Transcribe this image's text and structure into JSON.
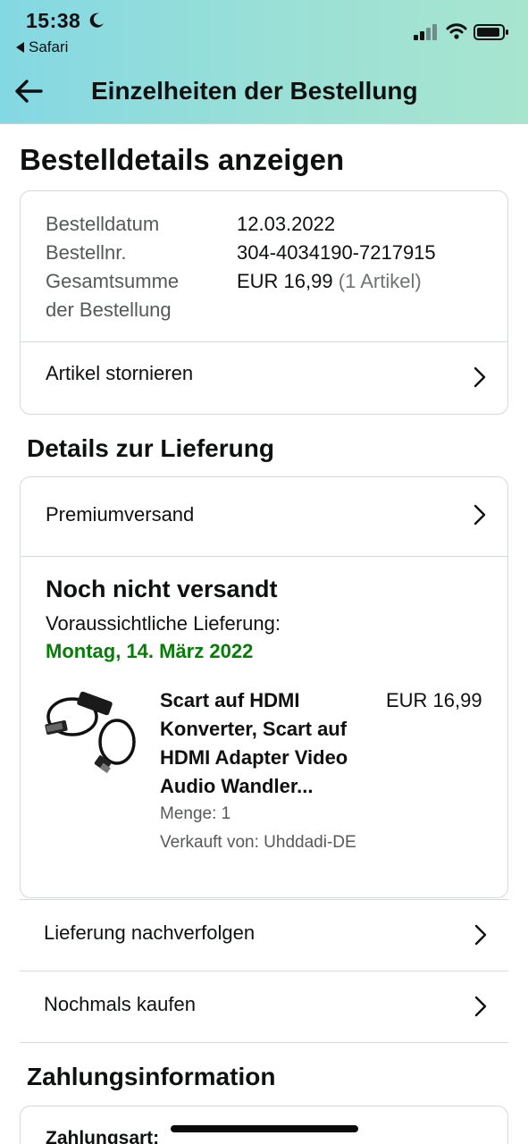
{
  "status_bar": {
    "time": "15:38",
    "back_app": "Safari"
  },
  "header": {
    "title": "Einzelheiten der Bestellung"
  },
  "page_title": "Bestelldetails anzeigen",
  "order_info": {
    "date_label": "Bestelldatum",
    "date_value": "12.03.2022",
    "number_label": "Bestellnr.",
    "number_value": "304-4034190-7217915",
    "total_label_line1": "Gesamtsumme",
    "total_label_line2": "der Bestellung",
    "total_value": "EUR 16,99",
    "total_items": "(1 Artikel)",
    "cancel_label": "Artikel stornieren"
  },
  "delivery": {
    "section_title": "Details zur Lieferung",
    "shipping_method": "Premiumversand",
    "status": "Noch nicht versandt",
    "expected_label": "Voraussichtliche Lieferung:",
    "expected_date": "Montag, 14. März 2022",
    "expected_date_color": "#067d06",
    "product": {
      "title_lines": [
        "Scart auf HDMI",
        "Konverter, Scart auf",
        "HDMI Adapter Video",
        "Audio Wandler..."
      ],
      "price": "EUR 16,99",
      "quantity": "Menge: 1",
      "seller": "Verkauft von: Uhddadi-DE",
      "image_icon": "scart-hdmi-cable-image"
    },
    "track_label": "Lieferung nachverfolgen",
    "buy_again_label": "Nochmals kaufen"
  },
  "payment": {
    "section_title": "Zahlungsinformation",
    "method_label": "Zahlungsart:"
  },
  "colors": {
    "header_gradient_start": "#84d8e3",
    "header_gradient_end": "#a7e5cf",
    "divider": "#d5d9d9"
  }
}
